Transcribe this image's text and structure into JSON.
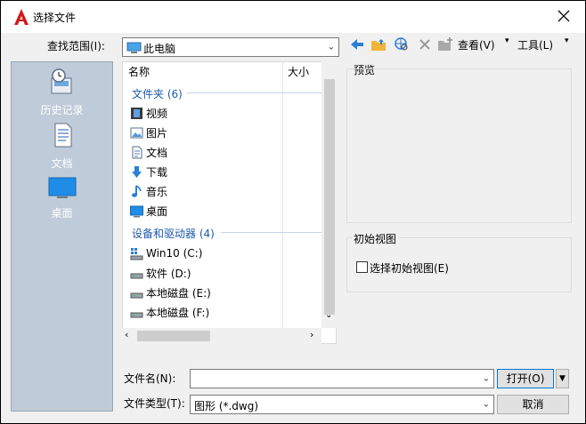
{
  "window": {
    "title": "选择文件"
  },
  "lookin": {
    "label": "查找范围(I):",
    "value": "此电脑"
  },
  "toolbar": {
    "views_label": "查看(V)",
    "tools_label": "工具(L)"
  },
  "sidebar": [
    {
      "label": "历史记录",
      "icon": "history-icon"
    },
    {
      "label": "文档",
      "icon": "documents-icon"
    },
    {
      "label": "桌面",
      "icon": "desktop-icon"
    }
  ],
  "list": {
    "col_name": "名称",
    "col_size": "大小",
    "group_folders": "文件夹 (6)",
    "folders": [
      "视频",
      "图片",
      "文档",
      "下载",
      "音乐",
      "桌面"
    ],
    "group_drives": "设备和驱动器 (4)",
    "drives": [
      "Win10 (C:)",
      "软件 (D:)",
      "本地磁盘 (E:)",
      "本地磁盘 (F:)"
    ]
  },
  "preview": {
    "label": "预览"
  },
  "initial_view": {
    "group_label": "初始视图",
    "checkbox_label": "选择初始视图(E)",
    "checked": false
  },
  "filename": {
    "label": "文件名(N):",
    "value": ""
  },
  "filetype": {
    "label": "文件类型(T):",
    "value": "图形 (*.dwg)"
  },
  "buttons": {
    "open": "打开(O)",
    "cancel": "取消"
  }
}
